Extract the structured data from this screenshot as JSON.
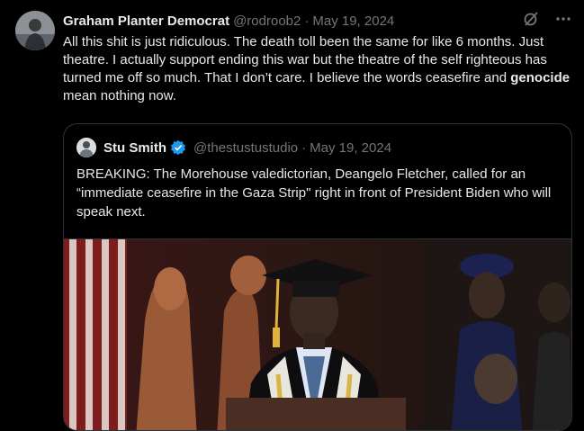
{
  "post": {
    "author_name": "Graham Planter Democrat",
    "author_handle": "@rodroob2",
    "separator": "·",
    "date": "May 19, 2024",
    "text_part1": "All this shit is just ridiculous. The death toll been the same for like 6 months. Just theatre. I actually support ending this war but the theatre of the self righteous has turned me off so much. That I don’t care. I believe the words ceasefire and ",
    "text_bold": "genocide",
    "text_part2": " mean nothing now."
  },
  "icons": {
    "grok": "grok-icon",
    "more": "more-options-icon",
    "verified": "verified-badge-icon"
  },
  "quoted": {
    "author_name": "Stu Smith",
    "author_handle": "@thestustustudio",
    "separator": "·",
    "date": "May 19, 2024",
    "text": "BREAKING: The Morehouse valedictorian, Deangelo Fletcher, called for an “immediate ceasefire in the Gaza Strip\" right in front of President Biden who will speak next."
  },
  "colors": {
    "background": "#000000",
    "text": "#e7e9ea",
    "muted": "#71767b",
    "border": "#2f3336",
    "verified": "#1d9bf0"
  }
}
